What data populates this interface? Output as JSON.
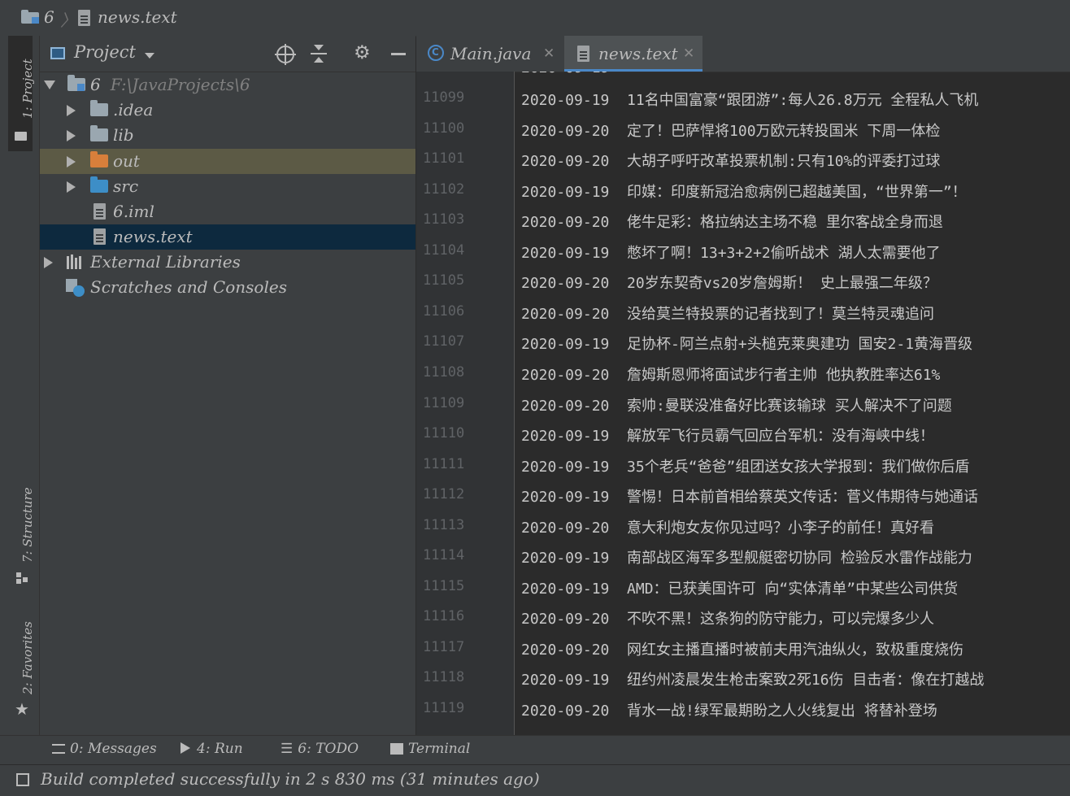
{
  "navbar": {
    "project": "6",
    "file": "news.text"
  },
  "tool_strip": {
    "project_tab": "1: Project",
    "structure_tab": "7: Structure",
    "favorites_tab": "2: Favorites"
  },
  "project_panel": {
    "title": "Project",
    "tree": [
      {
        "label": "6",
        "path": "F:\\JavaProjects\\6",
        "type": "module",
        "expanded": true
      },
      {
        "label": ".idea",
        "type": "folder"
      },
      {
        "label": "lib",
        "type": "folder"
      },
      {
        "label": "out",
        "type": "folder-excluded",
        "selected": true
      },
      {
        "label": "src",
        "type": "folder-source"
      },
      {
        "label": "6.iml",
        "type": "file"
      },
      {
        "label": "news.text",
        "type": "file",
        "active": true
      },
      {
        "label": "External Libraries",
        "type": "libraries"
      },
      {
        "label": "Scratches and Consoles",
        "type": "scratches"
      }
    ]
  },
  "editor": {
    "tabs": [
      {
        "label": "Main.java",
        "icon": "java-class-icon",
        "active": false
      },
      {
        "label": "news.text",
        "icon": "text-file-icon",
        "active": true
      }
    ],
    "lines": [
      {
        "num": "11099",
        "text": "2020-09-19  11名中国富豪“跟团游”:每人26.8万元 全程私人飞机"
      },
      {
        "num": "11100",
        "text": "2020-09-20  定了！巴萨悍将100万欧元转投国米 下周一体检"
      },
      {
        "num": "11101",
        "text": "2020-09-20  大胡子呼吁改革投票机制:只有10%的评委打过球"
      },
      {
        "num": "11102",
        "text": "2020-09-19  印媒：印度新冠治愈病例已超越美国，“世界第一”！"
      },
      {
        "num": "11103",
        "text": "2020-09-20  佬牛足彩：格拉纳达主场不稳 里尔客战全身而退"
      },
      {
        "num": "11104",
        "text": "2020-09-19  憋坏了啊！13+3+2+2偷听战术 湖人太需要他了"
      },
      {
        "num": "11105",
        "text": "2020-09-20  20岁东契奇vs20岁詹姆斯！ 史上最强二年级？"
      },
      {
        "num": "11106",
        "text": "2020-09-20  没给莫兰特投票的记者找到了！莫兰特灵魂追问"
      },
      {
        "num": "11107",
        "text": "2020-09-19  足协杯-阿兰点射+头槌克莱奥建功 国安2-1黄海晋级"
      },
      {
        "num": "11108",
        "text": "2020-09-20  詹姆斯恩师将面试步行者主帅 他执教胜率达61%"
      },
      {
        "num": "11109",
        "text": "2020-09-20  索帅:曼联没准备好比赛该输球 买人解决不了问题"
      },
      {
        "num": "11110",
        "text": "2020-09-19  解放军飞行员霸气回应台军机：没有海峡中线！"
      },
      {
        "num": "11111",
        "text": "2020-09-19  35个老兵“爸爸”组团送女孩大学报到：我们做你后盾"
      },
      {
        "num": "11112",
        "text": "2020-09-19  警惕！日本前首相给蔡英文传话：菅义伟期待与她通话"
      },
      {
        "num": "11113",
        "text": "2020-09-20  意大利炮女友你见过吗？小李子的前任！真好看"
      },
      {
        "num": "11114",
        "text": "2020-09-19  南部战区海军多型舰艇密切协同 检验反水雷作战能力"
      },
      {
        "num": "11115",
        "text": "2020-09-19  AMD：已获美国许可 向“实体清单”中某些公司供货"
      },
      {
        "num": "11116",
        "text": "2020-09-20  不吹不黑！这条狗的防守能力，可以完爆多少人"
      },
      {
        "num": "11117",
        "text": "2020-09-20  网红女主播直播时被前夫用汽油纵火，致极重度烧伤"
      },
      {
        "num": "11118",
        "text": "2020-09-19  纽约州凌晨发生枪击案致2死16伤 目击者：像在打越战"
      },
      {
        "num": "11119",
        "text": "2020-09-20  背水一战!绿军最期盼之人火线复出 将替补登场"
      }
    ]
  },
  "bottom_tabs": [
    {
      "label": "0: Messages",
      "icon": "messages-icon"
    },
    {
      "label": "4: Run",
      "icon": "run-icon"
    },
    {
      "label": "6: TODO",
      "icon": "todo-icon"
    },
    {
      "label": "Terminal",
      "icon": "terminal-icon"
    }
  ],
  "status": {
    "text": "Build completed successfully in 2 s 830 ms (31 minutes ago)"
  },
  "colors": {
    "panel_bg": "#3c3f41",
    "editor_bg": "#2b2b2b",
    "selection_bg": "#0d293e",
    "excluded_bg": "#5c5a45",
    "accent_tab": "#4a88c7",
    "folder_gray": "#9aa7b0",
    "folder_orange": "#d87f3b",
    "folder_blue": "#3d8ec7"
  }
}
